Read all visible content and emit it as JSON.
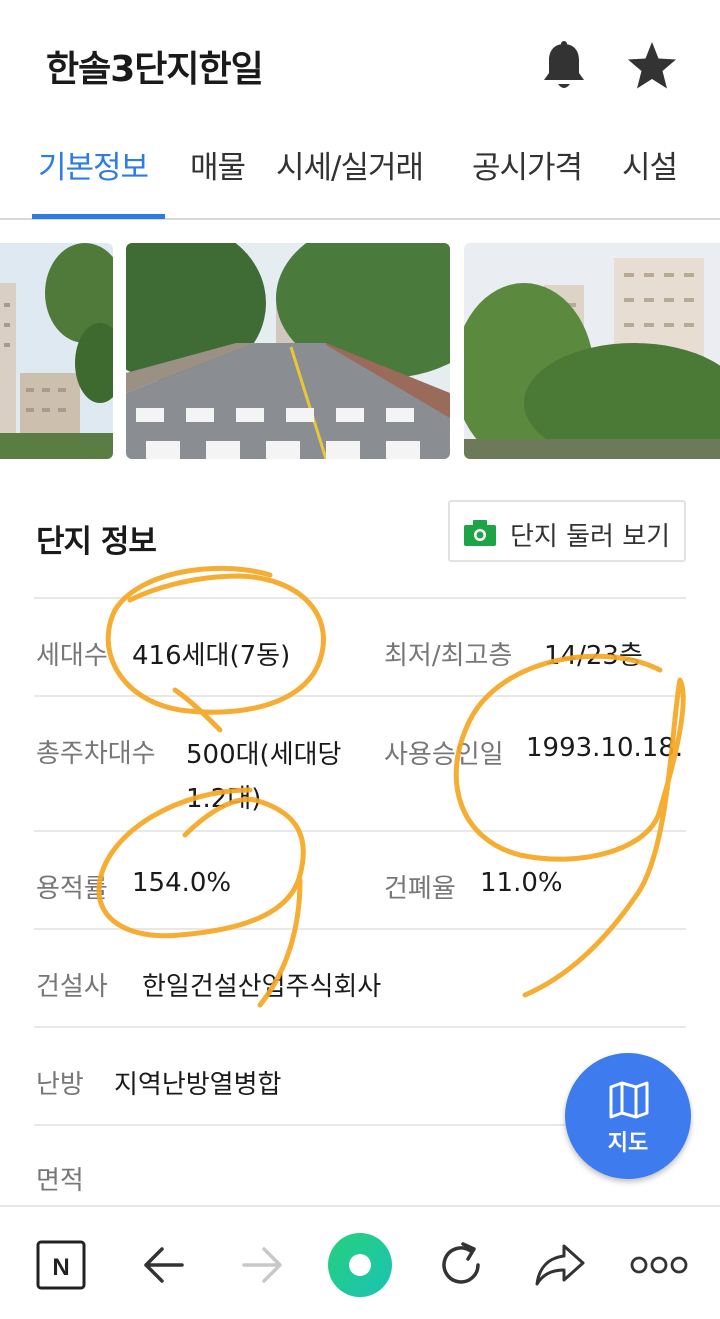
{
  "header": {
    "title": "한솔3단지한일",
    "bell_icon": "bell-icon",
    "star_icon": "star-icon"
  },
  "tabs": [
    {
      "label": "기본정보",
      "active": true
    },
    {
      "label": "매물",
      "active": false
    },
    {
      "label": "시세/실거래",
      "active": false
    },
    {
      "label": "공시가격",
      "active": false
    },
    {
      "label": "시설",
      "active": false
    }
  ],
  "section": {
    "title": "단지 정보",
    "tour_button_label": "단지 둘러 보기",
    "tour_icon": "camera-icon"
  },
  "info": {
    "households_label": "세대수",
    "households_value": "416세대(7동)",
    "floors_label": "최저/최고층",
    "floors_value": "14/23층",
    "parking_label": "총주차대수",
    "parking_value": "500대(세대당 1.2대)",
    "approval_label": "사용승인일",
    "approval_value": "1993.10.18.",
    "far_label": "용적률",
    "far_value": "154.0%",
    "bcr_label": "건폐율",
    "bcr_value": "11.0%",
    "builder_label": "건설사",
    "builder_value": "한일건설산업주식회사",
    "heating_label": "난방",
    "heating_value": "지역난방열병합",
    "area_label": "면적"
  },
  "map_button": {
    "label": "지도",
    "icon": "map-icon"
  },
  "bottom_bar": {
    "icons": [
      "naver-home-icon",
      "back-arrow-icon",
      "forward-arrow-icon",
      "green-dot-icon",
      "refresh-icon",
      "share-icon",
      "more-icon"
    ],
    "naver_letter": "N"
  },
  "colors": {
    "accent": "#2d7be5",
    "map_button": "#3d7bee",
    "annotation": "#f5a623",
    "camera_green": "#1fa347"
  }
}
